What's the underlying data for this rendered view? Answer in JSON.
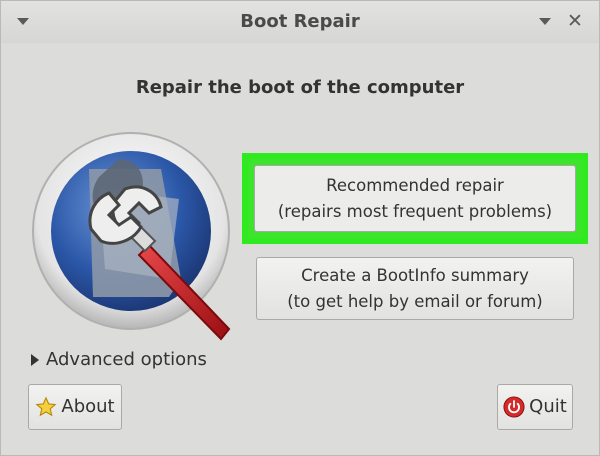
{
  "window": {
    "title": "Boot Repair",
    "close_glyph": "✕"
  },
  "main": {
    "heading": "Repair the boot of the computer",
    "recommended": {
      "line1": "Recommended repair",
      "line2": "(repairs most frequent problems)"
    },
    "bootinfo": {
      "line1": "Create a BootInfo summary",
      "line2": "(to get help by email or forum)"
    },
    "advanced_label": "Advanced options"
  },
  "footer": {
    "about_label": "About",
    "quit_label": "Quit"
  },
  "icons": {
    "logo": "disk-wrench-icon",
    "about": "star-icon",
    "quit": "power-icon"
  },
  "colors": {
    "highlight": "#2eea1e",
    "logo_blue": "#2b57a8",
    "wrench_red": "#c4161c"
  }
}
